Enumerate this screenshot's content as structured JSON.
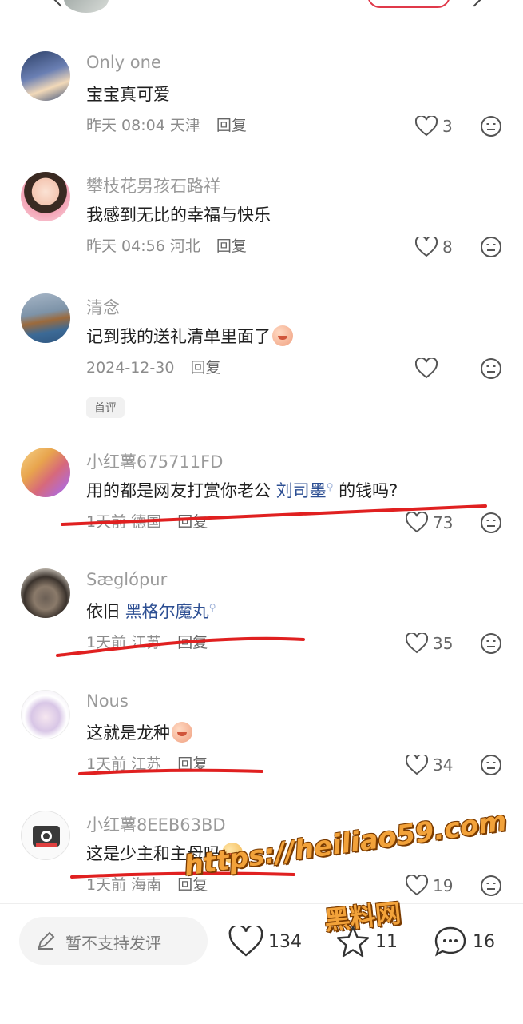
{
  "colors": {
    "accent": "#e0394a",
    "link": "#2d4f93",
    "underline": "#e02020",
    "watermark": "#f2a23a"
  },
  "comments": [
    {
      "name": "Only one",
      "text": "宝宝真可爱",
      "time": "昨天 08:04",
      "location": "天津",
      "reply": "回复",
      "likes": "3"
    },
    {
      "name": "攀枝花男孩石路祥",
      "text": "我感到无比的幸福与快乐",
      "time": "昨天 04:56",
      "location": "河北",
      "reply": "回复",
      "likes": "8"
    },
    {
      "name": "清念",
      "text": "记到我的送礼清单里面了",
      "time": "2024-12-30",
      "location": "",
      "reply": "回复",
      "likes": "",
      "badge": "首评"
    },
    {
      "name": "小红薯675711FD",
      "text_before": "用的都是网友打赏你老公",
      "link": "刘司墨",
      "text_after": "的钱吗?",
      "time": "1天前",
      "location": "德国",
      "reply": "回复",
      "likes": "73"
    },
    {
      "name": "Sæglópur",
      "text_before": "依旧",
      "link": "黑格尔魔丸",
      "time": "1天前",
      "location": "江苏",
      "reply": "回复",
      "likes": "35"
    },
    {
      "name": "Nous",
      "text": "这就是龙种",
      "time": "1天前",
      "location": "江苏",
      "reply": "回复",
      "likes": "34"
    },
    {
      "name": "小红薯8EEB63BD",
      "text": "这是少主和主母吗",
      "time": "1天前",
      "location": "海南",
      "reply": "回复",
      "likes": "19"
    }
  ],
  "bottom_bar": {
    "input_placeholder": "暂不支持发评",
    "likes": "134",
    "stars": "11",
    "comments": "16"
  },
  "watermark": {
    "url": "https://heiliao59.com",
    "name": "黑料网"
  }
}
